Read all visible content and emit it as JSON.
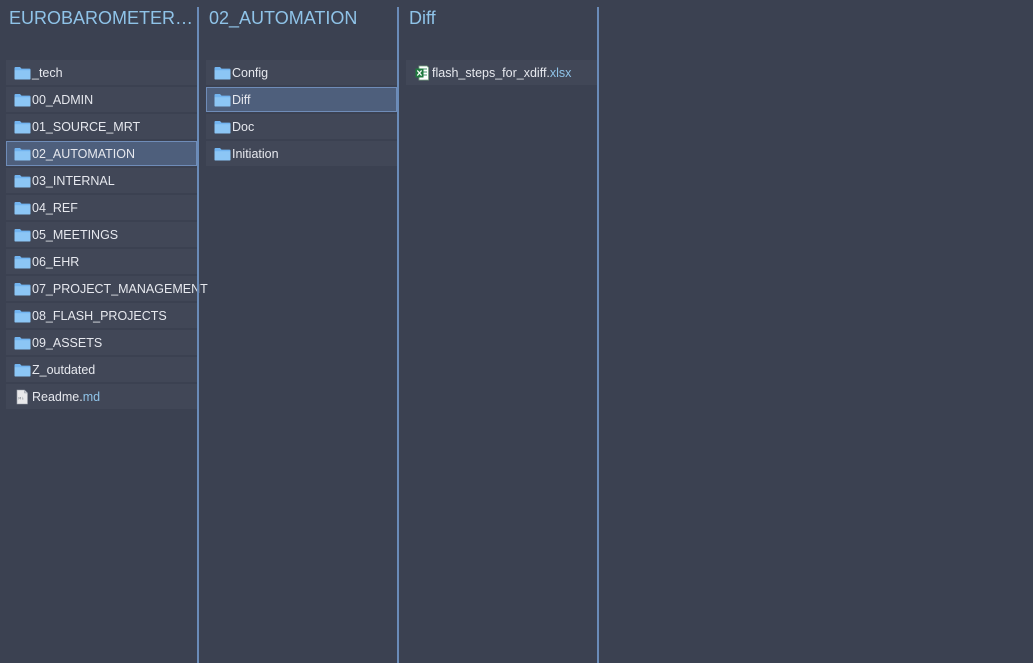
{
  "columns": [
    {
      "title": "EUROBAROMETER_FL...",
      "items": [
        {
          "label": "_tech",
          "ext": "",
          "icon": "folder-icon"
        },
        {
          "label": "00_ADMIN",
          "ext": "",
          "icon": "folder-icon"
        },
        {
          "label": "01_SOURCE_MRT",
          "ext": "",
          "icon": "folder-icon"
        },
        {
          "label": "02_AUTOMATION",
          "ext": "",
          "icon": "folder-icon",
          "selected": true
        },
        {
          "label": "03_INTERNAL",
          "ext": "",
          "icon": "folder-icon"
        },
        {
          "label": "04_REF",
          "ext": "",
          "icon": "folder-icon"
        },
        {
          "label": "05_MEETINGS",
          "ext": "",
          "icon": "folder-icon"
        },
        {
          "label": "06_EHR",
          "ext": "",
          "icon": "folder-icon"
        },
        {
          "label": "07_PROJECT_MANAGEMENT",
          "ext": "",
          "icon": "folder-icon"
        },
        {
          "label": "08_FLASH_PROJECTS",
          "ext": "",
          "icon": "folder-icon"
        },
        {
          "label": "09_ASSETS",
          "ext": "",
          "icon": "folder-icon"
        },
        {
          "label": "Z_outdated",
          "ext": "",
          "icon": "folder-icon"
        },
        {
          "label": "Readme.",
          "ext": "md",
          "icon": "markdown-file-icon"
        }
      ]
    },
    {
      "title": "02_AUTOMATION",
      "items": [
        {
          "label": "Config",
          "ext": "",
          "icon": "folder-icon"
        },
        {
          "label": "Diff",
          "ext": "",
          "icon": "folder-icon",
          "selected": true
        },
        {
          "label": "Doc",
          "ext": "",
          "icon": "folder-icon"
        },
        {
          "label": "Initiation",
          "ext": "",
          "icon": "folder-icon"
        }
      ]
    },
    {
      "title": "Diff",
      "items": [
        {
          "label": "flash_steps_for_xdiff.",
          "ext": "xlsx",
          "icon": "excel-file-icon"
        }
      ]
    }
  ],
  "colors": {
    "background": "#3b4151",
    "item_background": "#414757",
    "selected_background": "#4e5f7c",
    "title_color": "#8fc3e8",
    "extension_color": "#8fc3e8",
    "divider_color": "#6a8bb8",
    "folder_color": "#72b4f0",
    "excel_green": "#1f7a3e"
  }
}
